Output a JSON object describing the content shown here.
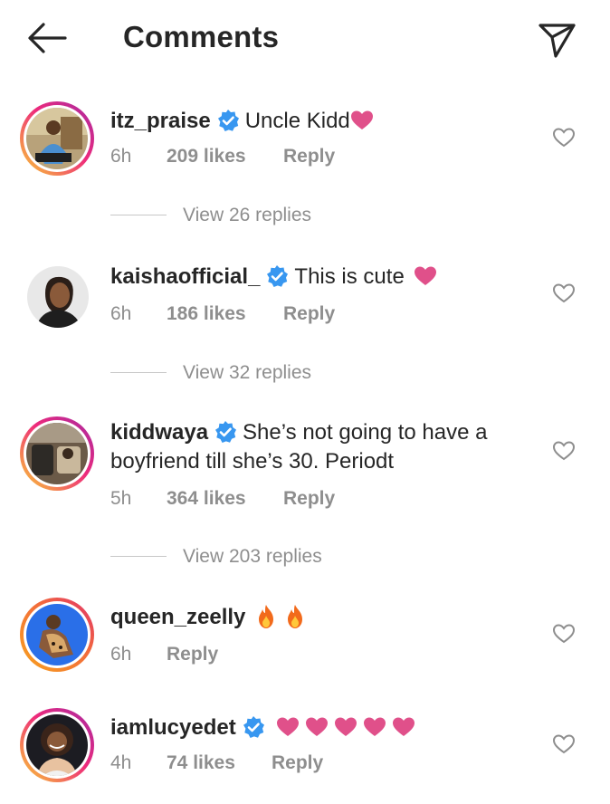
{
  "header": {
    "title": "Comments",
    "back_icon": "arrow-left-icon",
    "send_icon": "paper-plane-icon"
  },
  "colors": {
    "text": "#262626",
    "meta": "#8e8e8e",
    "verified_blue": "#3897f0",
    "heart_pink": "#e0508a",
    "fire": "#f26a1b"
  },
  "comments": [
    {
      "username": "itz_praise",
      "verified": true,
      "text": "Uncle Kidd",
      "emoji": [
        "pink-heart-icon"
      ],
      "time": "6h",
      "likes": "209 likes",
      "reply": "Reply",
      "view_replies": "View 26 replies"
    },
    {
      "username": "kaishaofficial_",
      "verified": true,
      "text": "This is cute",
      "emoji": [
        "pink-heart-icon"
      ],
      "time": "6h",
      "likes": "186 likes",
      "reply": "Reply",
      "view_replies": "View 32 replies"
    },
    {
      "username": "kiddwaya",
      "verified": true,
      "text": "She’s not going to have a boyfriend till she’s 30. Periodt",
      "time": "5h",
      "likes": "364 likes",
      "reply": "Reply",
      "view_replies": "View 203 replies"
    },
    {
      "username": "queen_zeelly",
      "verified": false,
      "emoji": [
        "fire-icon",
        "fire-icon"
      ],
      "time": "6h",
      "reply": "Reply"
    },
    {
      "username": "iamlucyedet",
      "verified": true,
      "emoji": [
        "pink-heart-icon",
        "pink-heart-icon",
        "pink-heart-icon",
        "pink-heart-icon",
        "pink-heart-icon"
      ],
      "time": "4h",
      "likes": "74 likes",
      "reply": "Reply"
    }
  ]
}
